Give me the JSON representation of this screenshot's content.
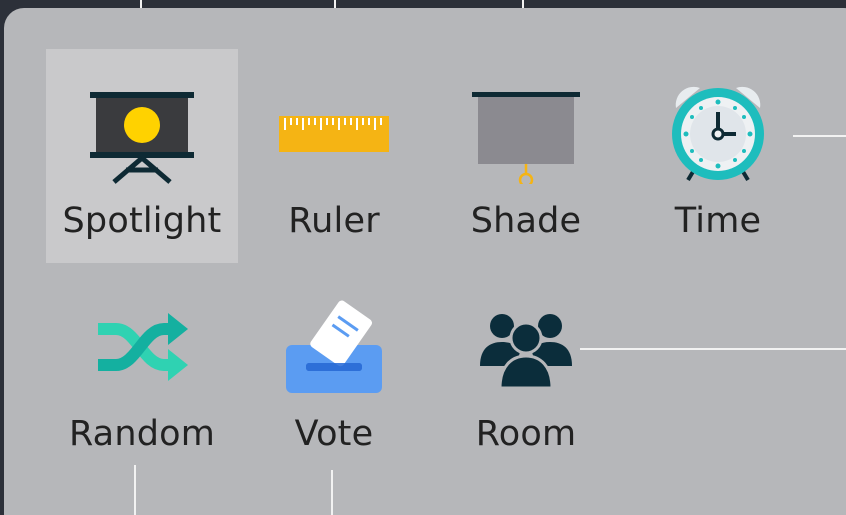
{
  "toolbox": {
    "active_tool": "Spotlight",
    "tools": [
      {
        "label": "Spotlight",
        "icon": "spotlight-icon"
      },
      {
        "label": "Ruler",
        "icon": "ruler-icon"
      },
      {
        "label": "Shade",
        "icon": "shade-icon"
      },
      {
        "label": "Time",
        "icon": "alarm-clock-icon"
      },
      {
        "label": "Random",
        "icon": "shuffle-icon"
      },
      {
        "label": "Vote",
        "icon": "ballot-box-icon"
      },
      {
        "label": "Room",
        "icon": "group-people-icon"
      }
    ]
  },
  "colors": {
    "panel_bg": "#b6b7ba",
    "page_bg": "#2c3039",
    "active_tile": "#c9c9cb",
    "callout_line": "#f2f2f2",
    "spotlight_yellow": "#ffd200",
    "ruler_orange": "#f5b414",
    "clock_teal": "#1ebdbd",
    "shuffle_teal": "#14b8a0",
    "vote_blue": "#3f8ff0",
    "room_dark": "#0b2d3b"
  }
}
